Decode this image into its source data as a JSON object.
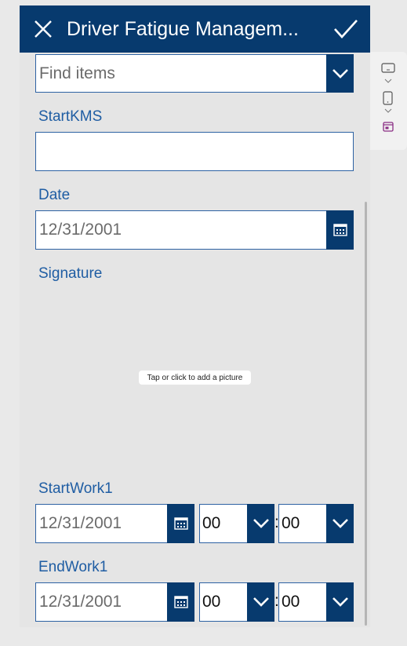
{
  "header": {
    "title": "Driver Fatigue Managem..."
  },
  "search": {
    "placeholder": "Find items"
  },
  "fields": {
    "startkms": {
      "label": "StartKMS",
      "value": ""
    },
    "date": {
      "label": "Date",
      "value": "12/31/2001"
    },
    "signature": {
      "label": "Signature",
      "hint": "Tap or click to add a picture"
    },
    "startwork": {
      "label": "StartWork1",
      "date": "12/31/2001",
      "hour": "00",
      "minute": "00",
      "separator": ":"
    },
    "endwork": {
      "label": "EndWork1",
      "date": "12/31/2001",
      "hour": "00",
      "minute": "00",
      "separator": ":"
    }
  },
  "colors": {
    "header": "#073a6e",
    "label": "#1f5da3",
    "border": "#2d62a3",
    "accent_purple": "#8a2d84"
  },
  "icons": [
    "close-icon",
    "check-icon",
    "chevron-down-icon",
    "calendar-icon",
    "monitor-icon",
    "phone-icon",
    "app-icon"
  ]
}
